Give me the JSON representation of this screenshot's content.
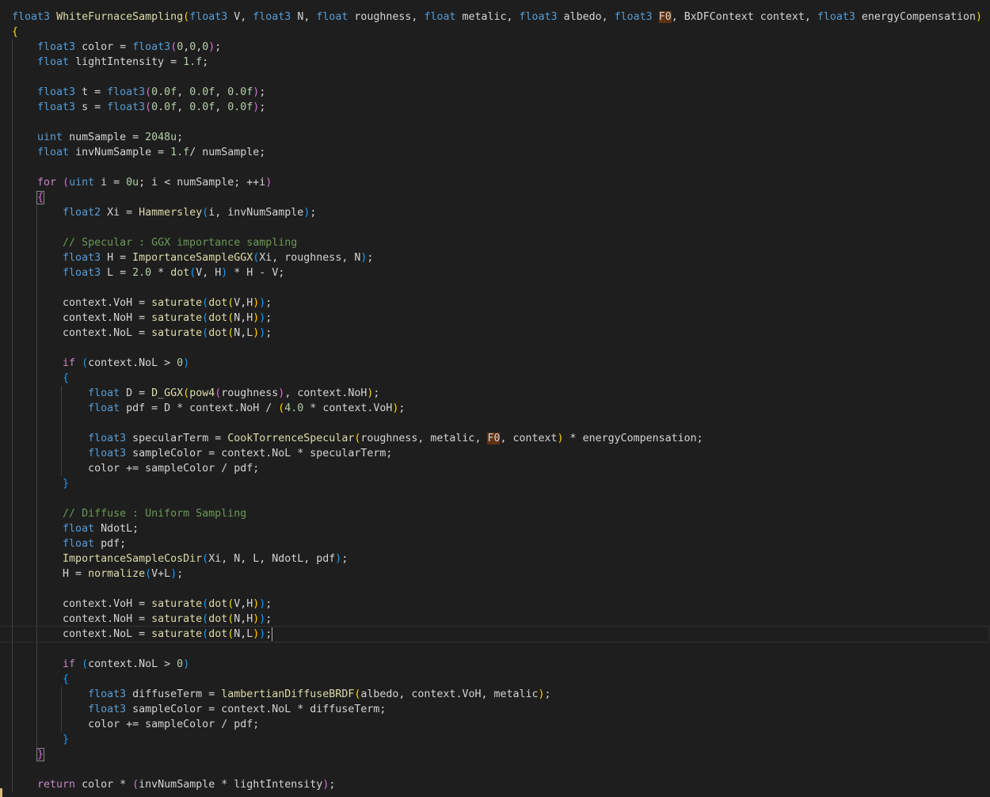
{
  "editor": {
    "language": "HLSL",
    "theme_background": "#1e1e1e",
    "current_line_number": 42,
    "colors": {
      "keyword": "#569cd6",
      "control": "#c586c0",
      "function": "#dcdcaa",
      "number": "#b5cea8",
      "comment": "#6a9955",
      "identifier": "#d4d4d4",
      "bracket_level_1": "#ffd700",
      "bracket_level_2": "#da70d6",
      "bracket_level_3": "#179fff",
      "word_highlight": "#613214"
    },
    "lines": [
      {
        "indent": 0,
        "tokens": [
          {
            "t": "float3",
            "c": "kw"
          },
          {
            "t": " "
          },
          {
            "t": "WhiteFurnaceSampling",
            "c": "fn"
          },
          {
            "t": "(",
            "c": "b1"
          },
          {
            "t": "float3",
            "c": "kw"
          },
          {
            "t": " V, "
          },
          {
            "t": "float3",
            "c": "kw"
          },
          {
            "t": " N, "
          },
          {
            "t": "float",
            "c": "kw"
          },
          {
            "t": " roughness, "
          },
          {
            "t": "float",
            "c": "kw"
          },
          {
            "t": " metalic, "
          },
          {
            "t": "float3",
            "c": "kw"
          },
          {
            "t": " albedo, "
          },
          {
            "t": "float3",
            "c": "kw"
          },
          {
            "t": " "
          },
          {
            "t": "F0",
            "c": "hl"
          },
          {
            "t": ", BxDFContext context, "
          },
          {
            "t": "float3",
            "c": "kw"
          },
          {
            "t": " energyCompensation"
          },
          {
            "t": ")",
            "c": "b1"
          }
        ]
      },
      {
        "indent": 0,
        "tokens": [
          {
            "t": "{",
            "c": "b1"
          }
        ]
      },
      {
        "indent": 1,
        "tokens": [
          {
            "t": "float3",
            "c": "kw"
          },
          {
            "t": " color = "
          },
          {
            "t": "float3",
            "c": "kw"
          },
          {
            "t": "(",
            "c": "b2"
          },
          {
            "t": "0",
            "c": "num"
          },
          {
            "t": ","
          },
          {
            "t": "0",
            "c": "num"
          },
          {
            "t": ","
          },
          {
            "t": "0",
            "c": "num"
          },
          {
            "t": ")",
            "c": "b2"
          },
          {
            "t": ";"
          }
        ]
      },
      {
        "indent": 1,
        "tokens": [
          {
            "t": "float",
            "c": "kw"
          },
          {
            "t": " lightIntensity = "
          },
          {
            "t": "1.f",
            "c": "num"
          },
          {
            "t": ";"
          }
        ]
      },
      {
        "indent": 0,
        "tokens": []
      },
      {
        "indent": 1,
        "tokens": [
          {
            "t": "float3",
            "c": "kw"
          },
          {
            "t": " t = "
          },
          {
            "t": "float3",
            "c": "kw"
          },
          {
            "t": "(",
            "c": "b2"
          },
          {
            "t": "0.0f",
            "c": "num"
          },
          {
            "t": ", "
          },
          {
            "t": "0.0f",
            "c": "num"
          },
          {
            "t": ", "
          },
          {
            "t": "0.0f",
            "c": "num"
          },
          {
            "t": ")",
            "c": "b2"
          },
          {
            "t": ";"
          }
        ]
      },
      {
        "indent": 1,
        "tokens": [
          {
            "t": "float3",
            "c": "kw"
          },
          {
            "t": " s = "
          },
          {
            "t": "float3",
            "c": "kw"
          },
          {
            "t": "(",
            "c": "b2"
          },
          {
            "t": "0.0f",
            "c": "num"
          },
          {
            "t": ", "
          },
          {
            "t": "0.0f",
            "c": "num"
          },
          {
            "t": ", "
          },
          {
            "t": "0.0f",
            "c": "num"
          },
          {
            "t": ")",
            "c": "b2"
          },
          {
            "t": ";"
          }
        ]
      },
      {
        "indent": 0,
        "tokens": []
      },
      {
        "indent": 1,
        "tokens": [
          {
            "t": "uint",
            "c": "kw"
          },
          {
            "t": " numSample = "
          },
          {
            "t": "2048u",
            "c": "num"
          },
          {
            "t": ";"
          }
        ]
      },
      {
        "indent": 1,
        "tokens": [
          {
            "t": "float",
            "c": "kw"
          },
          {
            "t": " invNumSample = "
          },
          {
            "t": "1.f",
            "c": "num"
          },
          {
            "t": "/ numSample;"
          }
        ]
      },
      {
        "indent": 0,
        "tokens": []
      },
      {
        "indent": 1,
        "tokens": [
          {
            "t": "for",
            "c": "ctl"
          },
          {
            "t": " "
          },
          {
            "t": "(",
            "c": "b2"
          },
          {
            "t": "uint",
            "c": "kw"
          },
          {
            "t": " i = "
          },
          {
            "t": "0u",
            "c": "num"
          },
          {
            "t": "; i < numSample; ++i"
          },
          {
            "t": ")",
            "c": "b2"
          }
        ]
      },
      {
        "indent": 1,
        "tokens": [
          {
            "t": "{",
            "c": "b2",
            "bm": true
          }
        ]
      },
      {
        "indent": 2,
        "tokens": [
          {
            "t": "float2",
            "c": "kw"
          },
          {
            "t": " Xi = "
          },
          {
            "t": "Hammersley",
            "c": "fn"
          },
          {
            "t": "(",
            "c": "b3"
          },
          {
            "t": "i, invNumSample"
          },
          {
            "t": ")",
            "c": "b3"
          },
          {
            "t": ";"
          }
        ]
      },
      {
        "indent": 0,
        "tokens": []
      },
      {
        "indent": 2,
        "tokens": [
          {
            "t": "// Specular : GGX importance sampling",
            "c": "cm"
          }
        ]
      },
      {
        "indent": 2,
        "tokens": [
          {
            "t": "float3",
            "c": "kw"
          },
          {
            "t": " H = "
          },
          {
            "t": "ImportanceSampleGGX",
            "c": "fn"
          },
          {
            "t": "(",
            "c": "b3"
          },
          {
            "t": "Xi, roughness, N"
          },
          {
            "t": ")",
            "c": "b3"
          },
          {
            "t": ";"
          }
        ]
      },
      {
        "indent": 2,
        "tokens": [
          {
            "t": "float3",
            "c": "kw"
          },
          {
            "t": " L = "
          },
          {
            "t": "2.0",
            "c": "num"
          },
          {
            "t": " * "
          },
          {
            "t": "dot",
            "c": "fn"
          },
          {
            "t": "(",
            "c": "b3"
          },
          {
            "t": "V, H"
          },
          {
            "t": ")",
            "c": "b3"
          },
          {
            "t": " * H - V;"
          }
        ]
      },
      {
        "indent": 0,
        "tokens": []
      },
      {
        "indent": 2,
        "tokens": [
          {
            "t": "context.VoH = "
          },
          {
            "t": "saturate",
            "c": "fn"
          },
          {
            "t": "(",
            "c": "b3"
          },
          {
            "t": "dot",
            "c": "fn"
          },
          {
            "t": "(",
            "c": "b1"
          },
          {
            "t": "V,H"
          },
          {
            "t": ")",
            "c": "b1"
          },
          {
            "t": ")",
            "c": "b3"
          },
          {
            "t": ";"
          }
        ]
      },
      {
        "indent": 2,
        "tokens": [
          {
            "t": "context.NoH = "
          },
          {
            "t": "saturate",
            "c": "fn"
          },
          {
            "t": "(",
            "c": "b3"
          },
          {
            "t": "dot",
            "c": "fn"
          },
          {
            "t": "(",
            "c": "b1"
          },
          {
            "t": "N,H"
          },
          {
            "t": ")",
            "c": "b1"
          },
          {
            "t": ")",
            "c": "b3"
          },
          {
            "t": ";"
          }
        ]
      },
      {
        "indent": 2,
        "tokens": [
          {
            "t": "context.NoL = "
          },
          {
            "t": "saturate",
            "c": "fn"
          },
          {
            "t": "(",
            "c": "b3"
          },
          {
            "t": "dot",
            "c": "fn"
          },
          {
            "t": "(",
            "c": "b1"
          },
          {
            "t": "N,L"
          },
          {
            "t": ")",
            "c": "b1"
          },
          {
            "t": ")",
            "c": "b3"
          },
          {
            "t": ";"
          }
        ]
      },
      {
        "indent": 0,
        "tokens": []
      },
      {
        "indent": 2,
        "tokens": [
          {
            "t": "if",
            "c": "ctl"
          },
          {
            "t": " "
          },
          {
            "t": "(",
            "c": "b3"
          },
          {
            "t": "context.NoL > "
          },
          {
            "t": "0",
            "c": "num"
          },
          {
            "t": ")",
            "c": "b3"
          }
        ]
      },
      {
        "indent": 2,
        "tokens": [
          {
            "t": "{",
            "c": "b3"
          }
        ]
      },
      {
        "indent": 3,
        "tokens": [
          {
            "t": "float",
            "c": "kw"
          },
          {
            "t": " D = "
          },
          {
            "t": "D_GGX",
            "c": "fn"
          },
          {
            "t": "(",
            "c": "b1"
          },
          {
            "t": "pow4",
            "c": "fn"
          },
          {
            "t": "(",
            "c": "b2"
          },
          {
            "t": "roughness"
          },
          {
            "t": ")",
            "c": "b2"
          },
          {
            "t": ", context.NoH"
          },
          {
            "t": ")",
            "c": "b1"
          },
          {
            "t": ";"
          }
        ]
      },
      {
        "indent": 3,
        "tokens": [
          {
            "t": "float",
            "c": "kw"
          },
          {
            "t": " pdf = D * context.NoH / "
          },
          {
            "t": "(",
            "c": "b1"
          },
          {
            "t": "4.0",
            "c": "num"
          },
          {
            "t": " * context.VoH"
          },
          {
            "t": ")",
            "c": "b1"
          },
          {
            "t": ";"
          }
        ]
      },
      {
        "indent": 0,
        "tokens": []
      },
      {
        "indent": 3,
        "tokens": [
          {
            "t": "float3",
            "c": "kw"
          },
          {
            "t": " specularTerm = "
          },
          {
            "t": "CookTorrenceSpecular",
            "c": "fn"
          },
          {
            "t": "(",
            "c": "b1"
          },
          {
            "t": "roughness, metalic, "
          },
          {
            "t": "F0",
            "c": "hl"
          },
          {
            "t": ", context"
          },
          {
            "t": ")",
            "c": "b1"
          },
          {
            "t": " * energyCompensation;"
          }
        ]
      },
      {
        "indent": 3,
        "tokens": [
          {
            "t": "float3",
            "c": "kw"
          },
          {
            "t": " sampleColor = context.NoL * specularTerm;"
          }
        ]
      },
      {
        "indent": 3,
        "tokens": [
          {
            "t": "color += sampleColor / pdf;"
          }
        ]
      },
      {
        "indent": 2,
        "tokens": [
          {
            "t": "}",
            "c": "b3"
          }
        ]
      },
      {
        "indent": 0,
        "tokens": []
      },
      {
        "indent": 2,
        "tokens": [
          {
            "t": "// Diffuse : Uniform Sampling",
            "c": "cm"
          }
        ]
      },
      {
        "indent": 2,
        "tokens": [
          {
            "t": "float",
            "c": "kw"
          },
          {
            "t": " NdotL;"
          }
        ]
      },
      {
        "indent": 2,
        "tokens": [
          {
            "t": "float",
            "c": "kw"
          },
          {
            "t": " pdf;"
          }
        ]
      },
      {
        "indent": 2,
        "tokens": [
          {
            "t": "ImportanceSampleCosDir",
            "c": "fn"
          },
          {
            "t": "(",
            "c": "b3"
          },
          {
            "t": "Xi, N, L, NdotL, pdf"
          },
          {
            "t": ")",
            "c": "b3"
          },
          {
            "t": ";"
          }
        ]
      },
      {
        "indent": 2,
        "tokens": [
          {
            "t": "H = "
          },
          {
            "t": "normalize",
            "c": "fn"
          },
          {
            "t": "(",
            "c": "b3"
          },
          {
            "t": "V+L"
          },
          {
            "t": ")",
            "c": "b3"
          },
          {
            "t": ";"
          }
        ]
      },
      {
        "indent": 0,
        "tokens": []
      },
      {
        "indent": 2,
        "tokens": [
          {
            "t": "context.VoH = "
          },
          {
            "t": "saturate",
            "c": "fn"
          },
          {
            "t": "(",
            "c": "b3"
          },
          {
            "t": "dot",
            "c": "fn"
          },
          {
            "t": "(",
            "c": "b1"
          },
          {
            "t": "V,H"
          },
          {
            "t": ")",
            "c": "b1"
          },
          {
            "t": ")",
            "c": "b3"
          },
          {
            "t": ";"
          }
        ]
      },
      {
        "indent": 2,
        "tokens": [
          {
            "t": "context.NoH = "
          },
          {
            "t": "saturate",
            "c": "fn"
          },
          {
            "t": "(",
            "c": "b3"
          },
          {
            "t": "dot",
            "c": "fn"
          },
          {
            "t": "(",
            "c": "b1"
          },
          {
            "t": "N,H"
          },
          {
            "t": ")",
            "c": "b1"
          },
          {
            "t": ")",
            "c": "b3"
          },
          {
            "t": ";"
          }
        ]
      },
      {
        "indent": 2,
        "current": true,
        "tokens": [
          {
            "t": "context.NoL = "
          },
          {
            "t": "saturate",
            "c": "fn"
          },
          {
            "t": "(",
            "c": "b3"
          },
          {
            "t": "dot",
            "c": "fn"
          },
          {
            "t": "(",
            "c": "b1"
          },
          {
            "t": "N,L"
          },
          {
            "t": ")",
            "c": "b1"
          },
          {
            "t": ")",
            "c": "b3"
          },
          {
            "t": ";"
          },
          {
            "caret": true
          }
        ]
      },
      {
        "indent": 0,
        "tokens": []
      },
      {
        "indent": 2,
        "tokens": [
          {
            "t": "if",
            "c": "ctl"
          },
          {
            "t": " "
          },
          {
            "t": "(",
            "c": "b3"
          },
          {
            "t": "context.NoL > "
          },
          {
            "t": "0",
            "c": "num"
          },
          {
            "t": ")",
            "c": "b3"
          }
        ]
      },
      {
        "indent": 2,
        "tokens": [
          {
            "t": "{",
            "c": "b3"
          }
        ]
      },
      {
        "indent": 3,
        "tokens": [
          {
            "t": "float3",
            "c": "kw"
          },
          {
            "t": " diffuseTerm = "
          },
          {
            "t": "lambertianDiffuseBRDF",
            "c": "fn"
          },
          {
            "t": "(",
            "c": "b1"
          },
          {
            "t": "albedo, context.VoH, metalic"
          },
          {
            "t": ")",
            "c": "b1"
          },
          {
            "t": ";"
          }
        ]
      },
      {
        "indent": 3,
        "tokens": [
          {
            "t": "float3",
            "c": "kw"
          },
          {
            "t": " sampleColor = context.NoL * diffuseTerm;"
          }
        ]
      },
      {
        "indent": 3,
        "tokens": [
          {
            "t": "color += sampleColor / pdf;"
          }
        ]
      },
      {
        "indent": 2,
        "tokens": [
          {
            "t": "}",
            "c": "b3"
          }
        ]
      },
      {
        "indent": 1,
        "tokens": [
          {
            "t": "}",
            "c": "b2",
            "bm": true
          }
        ]
      },
      {
        "indent": 0,
        "tokens": []
      },
      {
        "indent": 1,
        "tokens": [
          {
            "t": "return",
            "c": "ctl"
          },
          {
            "t": " color * "
          },
          {
            "t": "(",
            "c": "b2"
          },
          {
            "t": "invNumSample * lightIntensity"
          },
          {
            "t": ")",
            "c": "b2"
          },
          {
            "t": ";"
          }
        ]
      }
    ]
  }
}
